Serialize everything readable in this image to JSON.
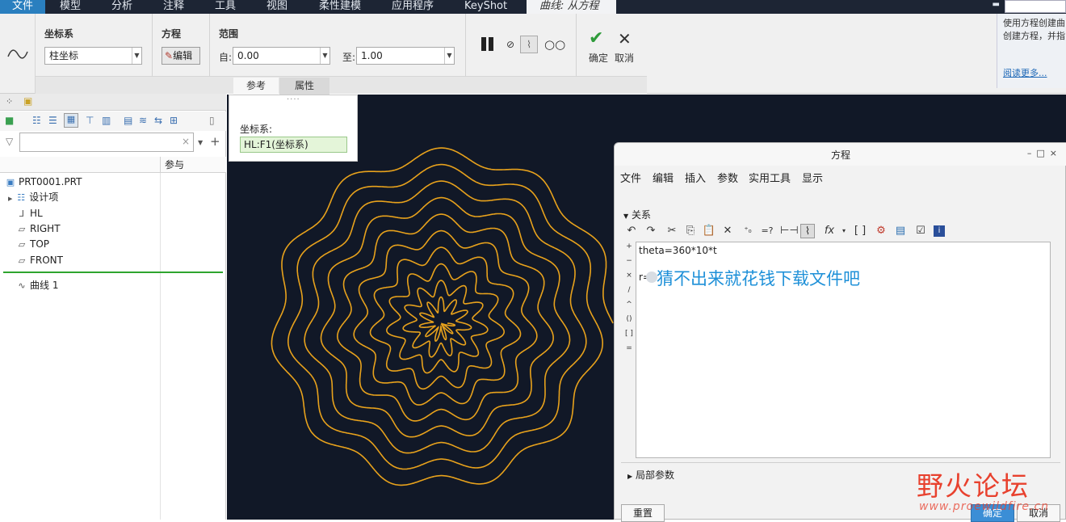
{
  "menubar": {
    "tabs": [
      "文件",
      "模型",
      "分析",
      "注释",
      "工具",
      "视图",
      "柔性建模",
      "应用程序",
      "KeyShot"
    ],
    "active_tab": "曲线: 从方程"
  },
  "ribbon": {
    "coord_group_title": "坐标系",
    "coord_type_value": "柱坐标",
    "equation_group_title": "方程",
    "edit_button": "编辑",
    "range_group_title": "范围",
    "from_label": "自:",
    "from_value": "0.00",
    "to_label": "至:",
    "to_value": "1.00",
    "ok_label": "确定",
    "cancel_label": "取消",
    "subtabs": [
      "参考",
      "属性"
    ]
  },
  "help": {
    "line1": "使用方程创建曲",
    "line2": "创建方程，并指",
    "link": "阅读更多..."
  },
  "tree": {
    "column_header": "参与",
    "nodes": [
      "PRT0001.PRT",
      "设计项",
      "HL",
      "RIGHT",
      "TOP",
      "FRONT",
      "曲线 1"
    ]
  },
  "reference_popup": {
    "label": "坐标系:",
    "value": "HL:F1(坐标系)"
  },
  "equation_dialog": {
    "title": "方程",
    "menus": [
      "文件",
      "编辑",
      "插入",
      "参数",
      "实用工具",
      "显示"
    ],
    "section": "关系",
    "operators": [
      "+",
      "−",
      "×",
      "/",
      "^",
      "()",
      "[ ]",
      "="
    ],
    "line1": "theta=360*10*t",
    "line2_prefix": "r=",
    "overlay_text": "猜不出来就花钱下载文件吧",
    "local_params": "局部参数",
    "reset_button": "重置",
    "ok_button": "确定",
    "cancel_button": "取消"
  },
  "watermark": {
    "big": "野火论坛",
    "small": "www.proewildfire.cn"
  },
  "colors": {
    "curve": "#e8a21c",
    "graphics_bg": "#111827",
    "menubar_bg": "#1d2534",
    "accent_blue": "#2a7fbf",
    "check_green": "#2e9b3a"
  }
}
